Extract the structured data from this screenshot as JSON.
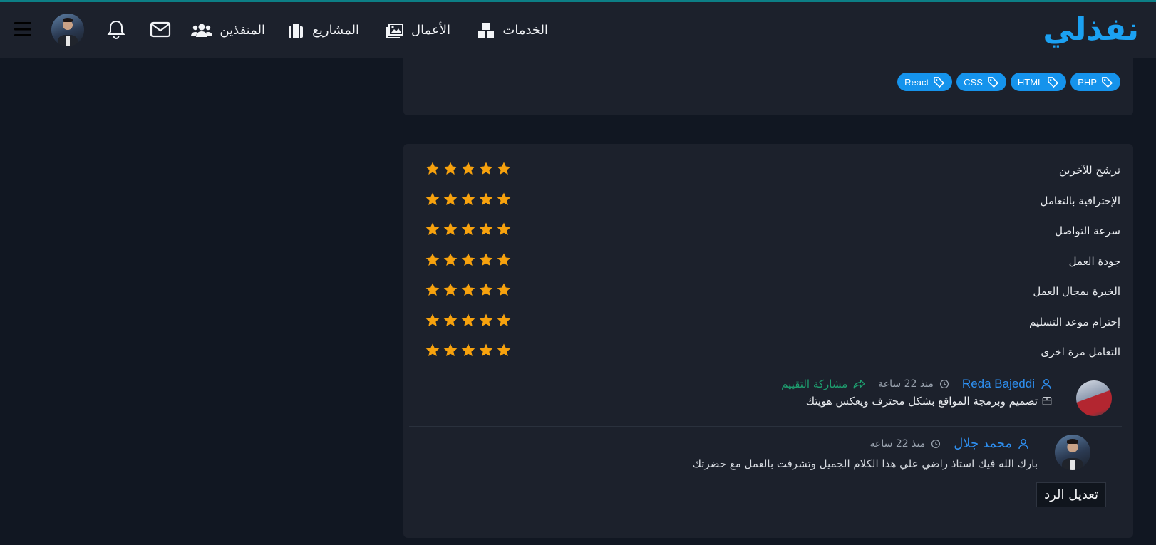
{
  "navbar": {
    "logo": "نفذلي",
    "items": [
      {
        "label": "الخدمات",
        "icon": "services-icon"
      },
      {
        "label": "الأعمال",
        "icon": "portfolio-icon"
      },
      {
        "label": "المشاريع",
        "icon": "projects-icon"
      },
      {
        "label": "المنفذين",
        "icon": "freelancers-icon"
      }
    ],
    "icons": [
      "mail-icon",
      "bell-icon",
      "avatar",
      "menu-icon"
    ]
  },
  "skills": {
    "tags": [
      "PHP",
      "HTML",
      "CSS",
      "React"
    ],
    "icon": "tag-icon"
  },
  "ratings": {
    "items": [
      {
        "label": "ترشح للآخرين",
        "stars": 5
      },
      {
        "label": "الإحترافية بالتعامل",
        "stars": 5
      },
      {
        "label": "سرعة التواصل",
        "stars": 5
      },
      {
        "label": "جودة العمل",
        "stars": 5
      },
      {
        "label": "الخبرة بمجال العمل",
        "stars": 5
      },
      {
        "label": "إحترام موعد التسليم",
        "stars": 5
      },
      {
        "label": "التعامل مرة اخرى",
        "stars": 5
      }
    ],
    "star_color": "#f7a20e",
    "max_stars": 5
  },
  "review": {
    "author": "Reda Bajeddi",
    "time": "منذ 22 ساعة",
    "share_label": "مشاركة التقييم",
    "service": "تصميم وبرمجة المواقع بشكل محترف ويعكس هويتك"
  },
  "reply": {
    "author": "محمد جلال",
    "time": "منذ 22 ساعة",
    "text": "بارك الله فيك استاذ راضي علي هذا الكلام الجميل وتشرفت بالعمل مع حضرتك",
    "edit_label": "تعديل الرد"
  },
  "colors": {
    "accent": "#1ba1f2",
    "link": "#2e8ff0",
    "share": "#1e9e6f",
    "topline": "#0c7f86"
  }
}
